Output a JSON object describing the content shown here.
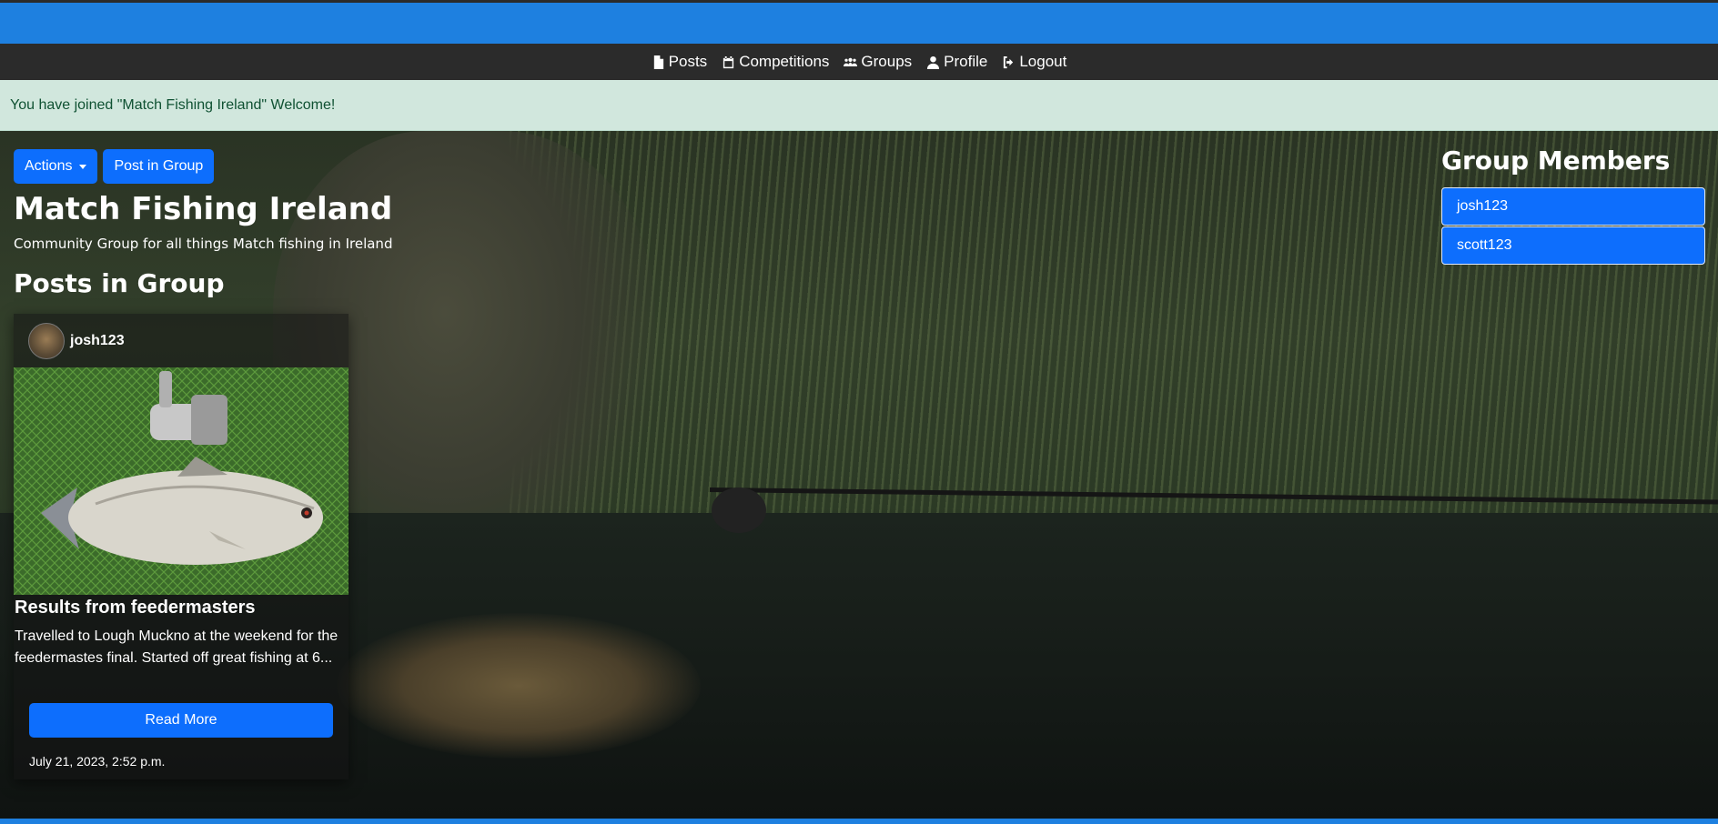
{
  "nav": {
    "items": [
      {
        "label": "Posts",
        "icon": "file-icon"
      },
      {
        "label": "Competitions",
        "icon": "calendar-icon"
      },
      {
        "label": "Groups",
        "icon": "users-icon"
      },
      {
        "label": "Profile",
        "icon": "user-icon"
      },
      {
        "label": "Logout",
        "icon": "logout-icon"
      }
    ]
  },
  "alert": {
    "text": "You have joined \"Match Fishing Ireland\" Welcome!"
  },
  "toolbar": {
    "actions_label": "Actions",
    "post_label": "Post in Group"
  },
  "group": {
    "title": "Match Fishing Ireland",
    "description": "Community Group for all things Match fishing in Ireland",
    "posts_heading": "Posts in Group"
  },
  "post": {
    "author": "josh123",
    "title": "Results from feedermasters",
    "body": "Travelled to Lough Muckno at the weekend for the feedermastes final. Started off great fishing at 6...",
    "read_more_label": "Read More",
    "date": "July 21, 2023, 2:52 p.m."
  },
  "members": {
    "heading": "Group Members",
    "list": [
      "josh123",
      "scott123"
    ]
  },
  "colors": {
    "primary": "#0d6efd",
    "topbar": "#1e80e0",
    "navbar": "#2b2b2b",
    "alert_bg": "#d1e7dd",
    "alert_text": "#0f5132"
  }
}
